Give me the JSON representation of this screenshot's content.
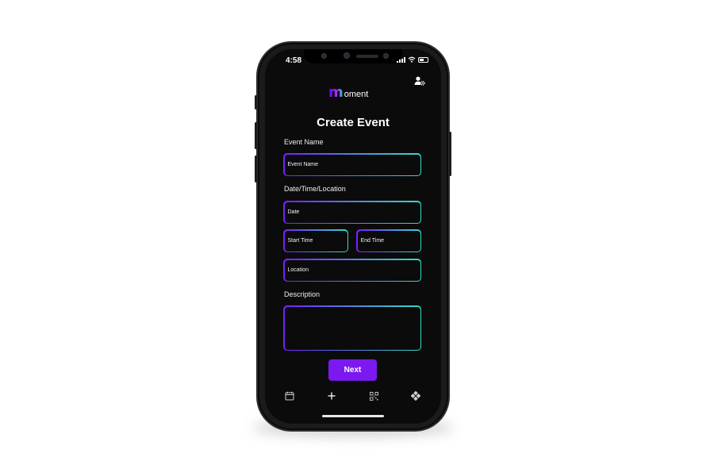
{
  "status_bar": {
    "time": "4:58"
  },
  "header": {
    "logo_letter": "m",
    "logo_rest": "oment",
    "settings_icon": "user-gear-icon"
  },
  "page": {
    "title": "Create Event"
  },
  "form": {
    "event_name_label": "Event Name",
    "event_name_placeholder": "Event Name",
    "datetime_label": "Date/Time/Location",
    "date_placeholder": "Date",
    "start_time_placeholder": "Start Time",
    "end_time_placeholder": "End Time",
    "location_placeholder": "Location",
    "description_label": "Description",
    "description_value": ""
  },
  "actions": {
    "next_label": "Next"
  },
  "tabbar": {
    "items": [
      "calendar-icon",
      "plus-icon",
      "qr-code-icon",
      "grid-icon"
    ]
  },
  "colors": {
    "accent": "#7b19f0",
    "gradient_start": "#7a1dff",
    "gradient_end": "#2fe0c4",
    "screen_bg": "#0b0b0c"
  }
}
